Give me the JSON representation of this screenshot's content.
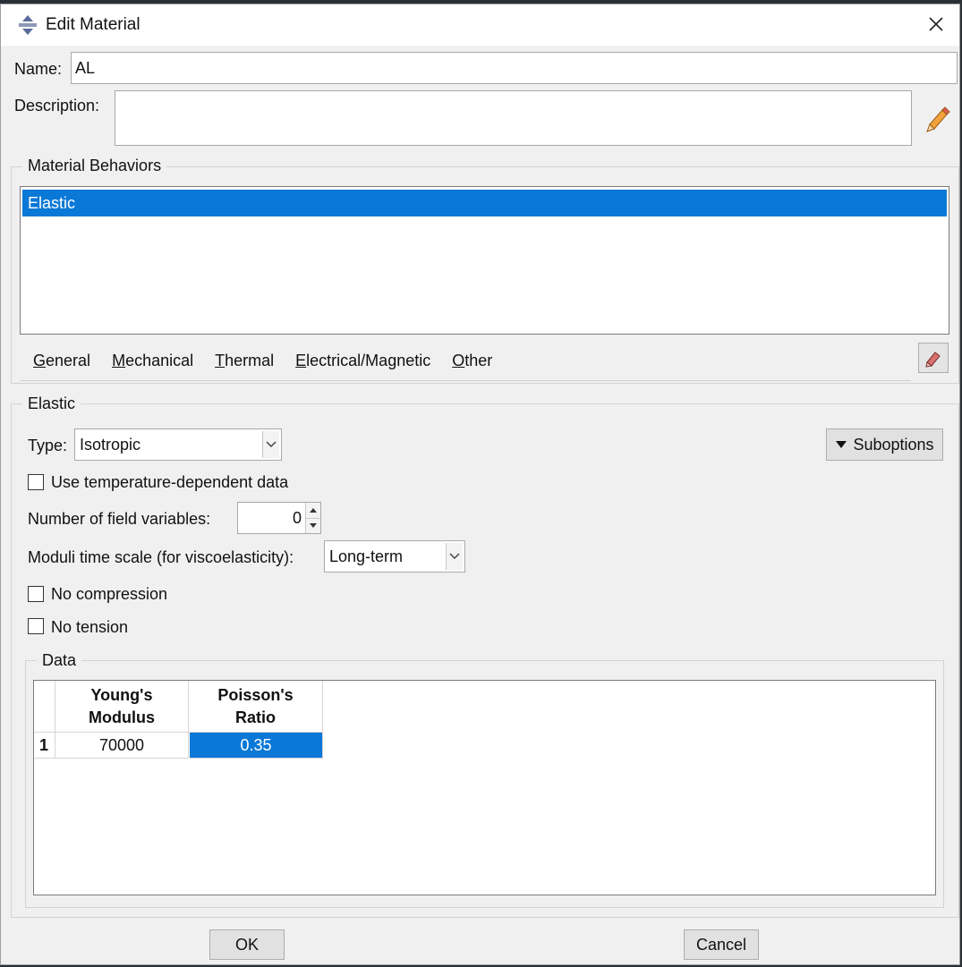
{
  "window": {
    "title": "Edit Material",
    "close_glyph": "✕"
  },
  "form": {
    "name_label": "Name:",
    "name_value": "AL",
    "description_label": "Description:",
    "description_value": ""
  },
  "behaviors": {
    "group_title": "Material Behaviors",
    "items": [
      {
        "label": "Elastic",
        "selected": true
      }
    ]
  },
  "menu": {
    "items": [
      {
        "key": "G",
        "rest": "eneral"
      },
      {
        "key": "M",
        "rest": "echanical"
      },
      {
        "key": "T",
        "rest": "hermal"
      },
      {
        "key": "E",
        "rest": "lectrical/Magnetic"
      },
      {
        "key": "O",
        "rest": "ther"
      }
    ]
  },
  "elastic": {
    "group_title": "Elastic",
    "type_label": "Type:",
    "type_value": "Isotropic",
    "suboptions_label": "Suboptions",
    "temp_dependent_label": "Use temperature-dependent data",
    "temp_dependent_checked": false,
    "field_vars_label": "Number of field variables:",
    "field_vars_value": "0",
    "moduli_label": "Moduli time scale (for viscoelasticity):",
    "moduli_value": "Long-term",
    "no_compression_label": "No compression",
    "no_compression_checked": false,
    "no_tension_label": "No tension",
    "no_tension_checked": false
  },
  "data_table": {
    "group_title": "Data",
    "columns": [
      {
        "line1": "Young's",
        "line2": "Modulus"
      },
      {
        "line1": "Poisson's",
        "line2": "Ratio"
      }
    ],
    "rows": [
      {
        "index": "1",
        "cells": [
          "70000",
          "0.35"
        ]
      }
    ]
  },
  "footer": {
    "ok_label": "OK",
    "cancel_label": "Cancel"
  },
  "colors": {
    "selection": "#0a78d7",
    "dialog_bg": "#f0f0f0"
  }
}
